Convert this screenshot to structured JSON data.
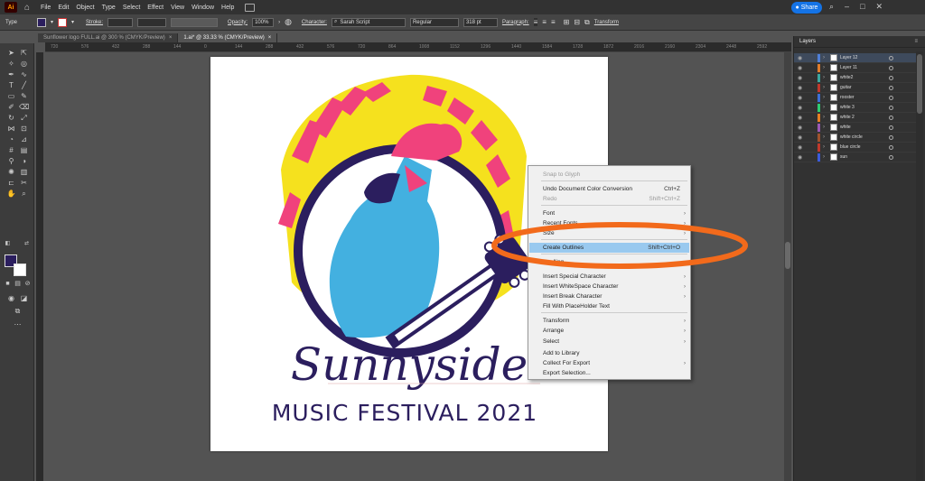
{
  "menubar": {
    "logo": "Ai",
    "items": [
      "File",
      "Edit",
      "Object",
      "Type",
      "Select",
      "Effect",
      "View",
      "Window",
      "Help"
    ],
    "share_label": "Share"
  },
  "control": {
    "type_label": "Type",
    "stroke_label": "Stroke:",
    "opacity_label": "Opacity:",
    "opacity_value": "100%",
    "character_label": "Character:",
    "font_family": "Sarah Script",
    "font_style": "Regular",
    "font_size": "318 pt",
    "paragraph_label": "Paragraph:",
    "transform_label": "Transform"
  },
  "tabs": [
    {
      "label": "Sunflower logo FULL.ai @ 300 % (CMYK/Preview)"
    },
    {
      "label": "1.ai* @ 33.33 % (CMYK/Preview)"
    }
  ],
  "ruler": [
    "720",
    "576",
    "432",
    "288",
    "144",
    "0",
    "144",
    "288",
    "432",
    "576",
    "720",
    "864",
    "1008",
    "1152",
    "1296",
    "1440",
    "1584",
    "1728",
    "1872",
    "2016",
    "2160",
    "2304",
    "2448",
    "2592"
  ],
  "artwork": {
    "title": "Sunnyside",
    "subtitle": "MUSIC FESTIVAL 2021"
  },
  "context_menu": {
    "items": [
      {
        "label": "Snap to Glyph",
        "shortcut": "",
        "disabled": true,
        "submenu": false
      },
      {
        "label": "Undo Document Color Conversion",
        "shortcut": "Ctrl+Z",
        "disabled": false,
        "submenu": false
      },
      {
        "label": "Redo",
        "shortcut": "Shift+Ctrl+Z",
        "disabled": true,
        "submenu": false
      },
      {
        "label": "Font",
        "shortcut": "",
        "disabled": false,
        "submenu": true
      },
      {
        "label": "Recent Fonts",
        "shortcut": "",
        "disabled": false,
        "submenu": true
      },
      {
        "label": "Size",
        "shortcut": "",
        "disabled": false,
        "submenu": true
      },
      {
        "label": "Create Outlines",
        "shortcut": "Shift+Ctrl+O",
        "disabled": false,
        "submenu": false,
        "highlighted": true
      },
      {
        "label": "Spelling",
        "shortcut": "",
        "disabled": false,
        "submenu": true
      },
      {
        "label": "Insert Special Character",
        "shortcut": "",
        "disabled": false,
        "submenu": true
      },
      {
        "label": "Insert WhiteSpace Character",
        "shortcut": "",
        "disabled": false,
        "submenu": true
      },
      {
        "label": "Insert Break Character",
        "shortcut": "",
        "disabled": false,
        "submenu": true
      },
      {
        "label": "Fill With PlaceHolder Text",
        "shortcut": "",
        "disabled": false,
        "submenu": false
      },
      {
        "label": "Transform",
        "shortcut": "",
        "disabled": false,
        "submenu": true
      },
      {
        "label": "Arrange",
        "shortcut": "",
        "disabled": false,
        "submenu": true
      },
      {
        "label": "Select",
        "shortcut": "",
        "disabled": false,
        "submenu": true
      },
      {
        "label": "Add to Library",
        "shortcut": "",
        "disabled": false,
        "submenu": false
      },
      {
        "label": "Collect For Export",
        "shortcut": "",
        "disabled": false,
        "submenu": true
      },
      {
        "label": "Export Selection...",
        "shortcut": "",
        "disabled": false,
        "submenu": false
      }
    ]
  },
  "layers_panel": {
    "title": "Layers",
    "layers": [
      {
        "name": "Layer 12",
        "color": "#4f7fd8",
        "selected": true
      },
      {
        "name": "Layer 11",
        "color": "#e07b2a"
      },
      {
        "name": "white2",
        "color": "#3aa7a0"
      },
      {
        "name": "guitar",
        "color": "#c0392b"
      },
      {
        "name": "rooster",
        "color": "#3d6fd6"
      },
      {
        "name": "white 3",
        "color": "#2ecc71"
      },
      {
        "name": "white 2",
        "color": "#e67e22"
      },
      {
        "name": "white",
        "color": "#9b59b6"
      },
      {
        "name": "white circle",
        "color": "#a0522d"
      },
      {
        "name": "blue circle",
        "color": "#c0392b"
      },
      {
        "name": "sun",
        "color": "#3b5bdb"
      }
    ]
  },
  "colors": {
    "highlight": "#99c9ef",
    "annotation": "#f26a1b",
    "accent": "#1473e6",
    "navy": "#2b1e5e",
    "pink": "#f0427c",
    "yellow": "#f5e11e",
    "cyan": "#43b0e0"
  }
}
